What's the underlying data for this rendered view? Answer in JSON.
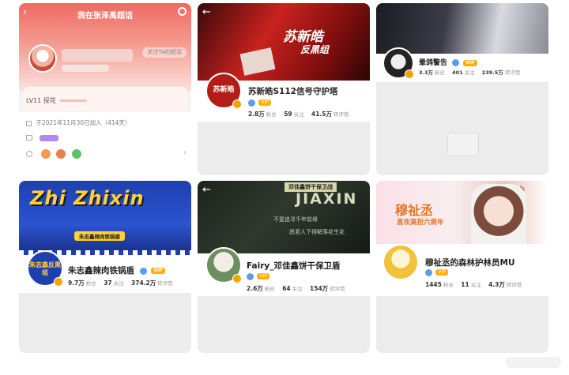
{
  "cards": {
    "c1": {
      "title": "我在张泽禹超话",
      "back_icon": "back-arrow-icon",
      "settings_icon": "gear-icon",
      "follow_button": "关注TA的超话",
      "level_label": "LV11 探花",
      "join_text": "于2021年11月30日加入（414天）",
      "accent": "#f0524e"
    },
    "c2": {
      "banner_title": "苏新皓",
      "banner_sub": "反黑组",
      "avatar_text": "苏新皓",
      "name": "苏新皓S112信号守护塔",
      "badge": "VIP",
      "fans": "2.8万",
      "fans_label": "粉丝",
      "follow": "59",
      "follow_label": "关注",
      "reposts": "41.5万",
      "reposts_label": "转评赞"
    },
    "c3": {
      "name": "晕鸽警告",
      "badge": "VIP",
      "fans": "3.3万",
      "fans_label": "粉丝",
      "follow": "401",
      "follow_label": "关注",
      "reposts": "239.5万",
      "reposts_label": "转评赞"
    },
    "c4": {
      "banner_title": "Zhi Zhixin",
      "banner_sub": "朱志鑫辣肉铁锅盾",
      "avatar_text": "朱志鑫反黑组",
      "name": "朱志鑫辣肉铁锅盾",
      "badge": "VIP",
      "fans": "9.7万",
      "fans_label": "粉丝",
      "follow": "37",
      "follow_label": "关注",
      "reposts": "374.2万",
      "reposts_label": "转评赞"
    },
    "c5": {
      "banner_title": "JIAXIN",
      "banner_tag": "邓佳鑫饼干保卫战",
      "banner_line1": "不复追寻千年前缘",
      "banner_line2": "愿君人下得解落花生花",
      "name": "Fairy_邓佳鑫饼干保卫盾",
      "badge": "VIP",
      "fans": "2.6万",
      "fans_label": "粉丝",
      "follow": "64",
      "follow_label": "关注",
      "reposts": "154万",
      "reposts_label": "转评赞"
    },
    "c6": {
      "banner_title": "穆祉丞",
      "banner_sub": "直攻高担六周年",
      "banner_tag": "6th",
      "name": "穆祉丞的森林护林员MU",
      "badge": "VIP",
      "fans": "1445",
      "fans_label": "粉丝",
      "follow": "11",
      "follow_label": "关注",
      "reposts": "4.3万",
      "reposts_label": "转评赞"
    }
  }
}
